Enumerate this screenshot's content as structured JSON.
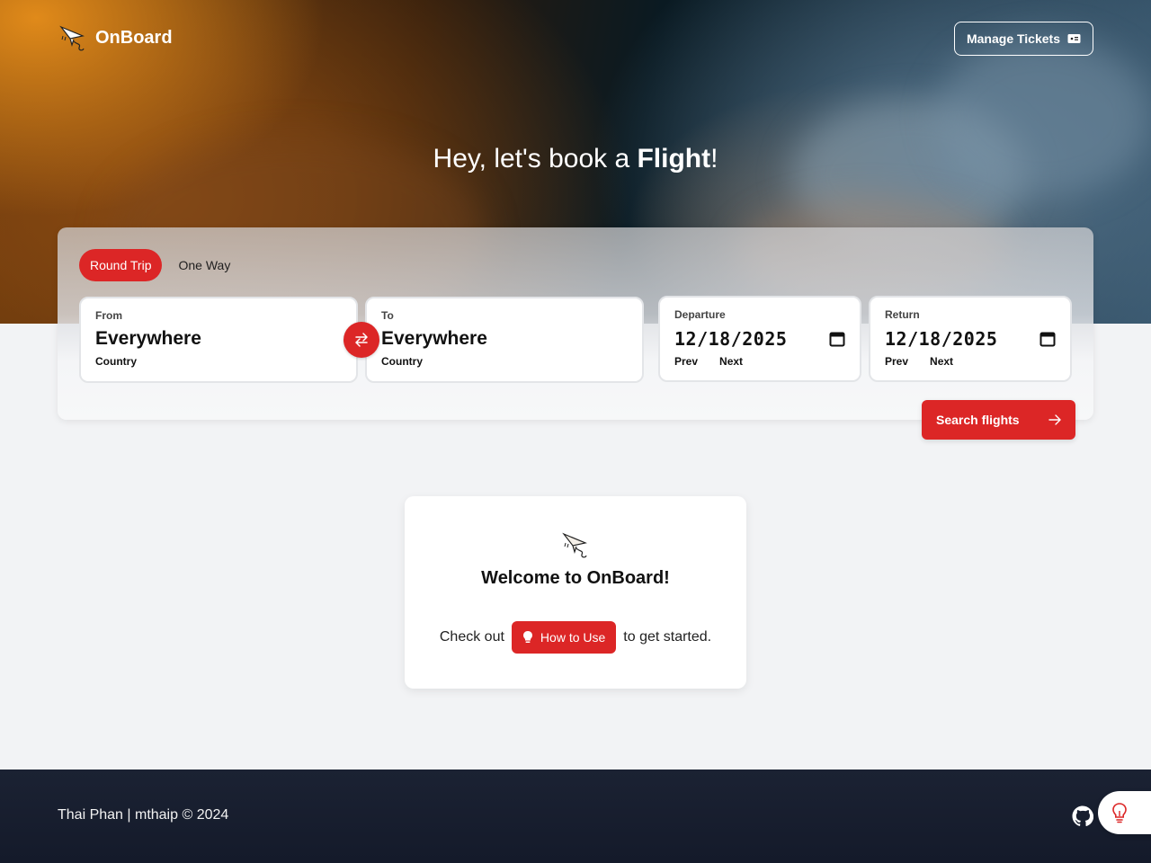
{
  "brand": {
    "name": "OnBoard",
    "logo_icon": "paper-plane-icon"
  },
  "header": {
    "manage_tickets_label": "Manage Tickets",
    "ticket_icon": "ticket-icon"
  },
  "hero": {
    "headline_prefix": "Hey, let's book a ",
    "headline_emphasis": "Flight",
    "headline_suffix": "!"
  },
  "search": {
    "tabs": [
      {
        "label": "Round Trip",
        "active": true
      },
      {
        "label": "One Way",
        "active": false
      }
    ],
    "from": {
      "label": "From",
      "value": "Everywhere",
      "sub": "Country"
    },
    "to": {
      "label": "To",
      "value": "Everywhere",
      "sub": "Country"
    },
    "departure": {
      "label": "Departure",
      "value": "12/18/2025",
      "prev": "Prev",
      "next": "Next"
    },
    "return": {
      "label": "Return",
      "value": "12/18/2025",
      "prev": "Prev",
      "next": "Next"
    },
    "submit_label": "Search flights"
  },
  "welcome": {
    "title": "Welcome to OnBoard!",
    "prefix": "Check out",
    "button_label": "How to Use",
    "suffix": "to get started."
  },
  "footer": {
    "credit": "Thai Phan | mthaip © 2024"
  },
  "colors": {
    "accent": "#dc2626",
    "footer_bg": "#1b2233",
    "page_bg": "#f2f3f5"
  }
}
